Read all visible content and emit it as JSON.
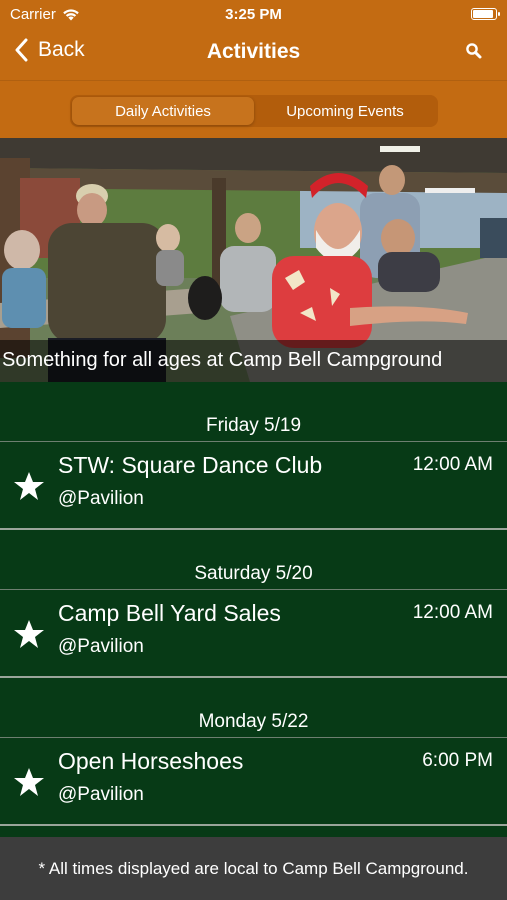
{
  "status": {
    "carrier": "Carrier",
    "time": "3:25 PM"
  },
  "nav": {
    "back_label": "Back",
    "title": "Activities"
  },
  "tabs": [
    {
      "label": "Daily Activities",
      "active": true
    },
    {
      "label": "Upcoming Events",
      "active": false
    }
  ],
  "hero": {
    "caption": "Something for all ages at Camp Bell Campground"
  },
  "days": [
    {
      "date": "Friday 5/19",
      "events": [
        {
          "title": "STW: Square Dance Club",
          "location": "@Pavilion",
          "time": "12:00 AM"
        }
      ]
    },
    {
      "date": "Saturday 5/20",
      "events": [
        {
          "title": "Camp Bell Yard Sales",
          "location": "@Pavilion",
          "time": "12:00 AM"
        }
      ]
    },
    {
      "date": "Monday 5/22",
      "events": [
        {
          "title": "Open Horseshoes",
          "location": "@Pavilion",
          "time": "6:00 PM"
        }
      ]
    }
  ],
  "footer": {
    "note": "* All times displayed are local to Camp Bell Campground."
  },
  "colors": {
    "brand": "#c36b12",
    "list_bg": "#073a16",
    "footer_bg": "#3d3d3d"
  }
}
